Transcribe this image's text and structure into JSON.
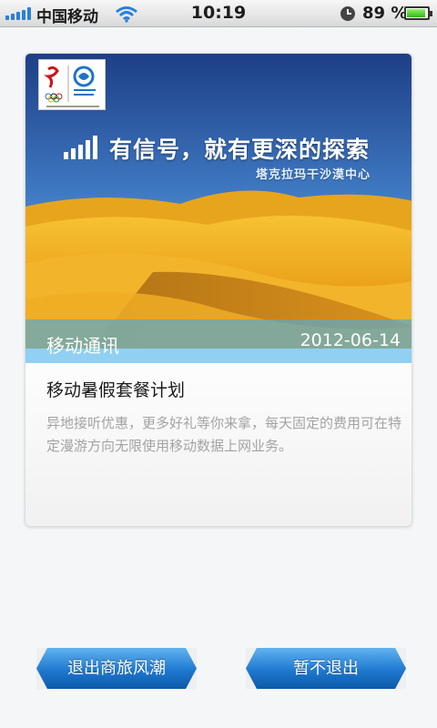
{
  "status_bar": {
    "carrier": "中国移动",
    "time": "10:19",
    "battery_percent": "89 %",
    "battery_level": 0.89,
    "signal_icon": "signal-bars-icon",
    "wifi_icon": "wifi-icon",
    "alarm_icon": "clock-icon",
    "battery_icon": "battery-icon"
  },
  "card": {
    "banner": {
      "slogan": "有信号，就有更深的探索",
      "location": "塔克拉玛干沙漠中心",
      "logo_icon": "beijing-2008-china-mobile-logo"
    },
    "category": "移动通讯",
    "date": "2012-06-14",
    "title": "移动暑假套餐计划",
    "description": "异地接听优惠，更多好礼等你来拿，每天固定的费用可在特定漫游方向无限使用移动数据上网业务。"
  },
  "buttons": {
    "exit_label": "退出商旅风潮",
    "stay_label": "暂不退出"
  },
  "colors": {
    "button_blue": "#1f78cf",
    "caption_bar": "#5ca8c8",
    "desc_text": "#a3a3a3"
  }
}
